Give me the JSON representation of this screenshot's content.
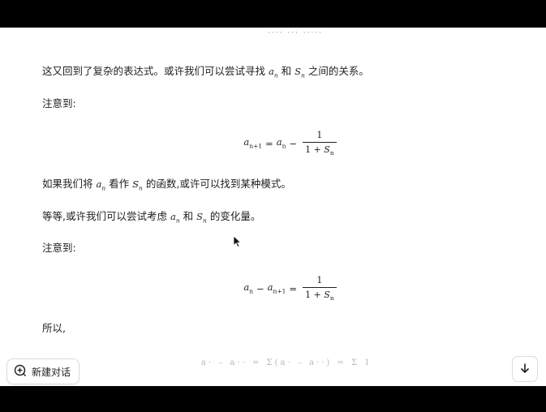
{
  "messages": {
    "p1": {
      "pre": "这又回到了复杂的表达式。或许我们可以尝试寻找 ",
      "var1": "a",
      "sub1": "n",
      "mid": " 和 ",
      "var2": "S",
      "sub2": "n",
      "post": " 之间的关系。"
    },
    "p2": "注意到:",
    "eq1": {
      "lhs_var": "a",
      "lhs_sub": "n+1",
      "eq": "=",
      "rhs_var": "a",
      "rhs_sub": "n",
      "op": "−",
      "num": "1",
      "den_pre": "1 + ",
      "den_var": "S",
      "den_sub": "n"
    },
    "p3": {
      "pre": "如果我们将 ",
      "var1": "a",
      "sub1": "n",
      "mid": " 看作 ",
      "var2": "S",
      "sub2": "n",
      "post": " 的函数,或许可以找到某种模式。"
    },
    "p4": {
      "pre": "等等,或许我们可以尝试考虑 ",
      "var1": "a",
      "sub1": "n",
      "mid": " 和 ",
      "var2": "S",
      "sub2": "n",
      "post": " 的变化量。"
    },
    "p5": "注意到:",
    "eq2": {
      "a_var": "a",
      "a_sub": "n",
      "op": "−",
      "b_var": "a",
      "b_sub": "n+1",
      "eq": "=",
      "num": "1",
      "den_pre": "1 + ",
      "den_var": "S",
      "den_sub": "n"
    },
    "p6": "所以,"
  },
  "buttons": {
    "new_chat_label": "新建对话"
  },
  "icons": {
    "new_chat": "plus-circle-icon",
    "scroll_down": "arrow-down-icon",
    "cursor": "mouse-pointer-icon"
  }
}
